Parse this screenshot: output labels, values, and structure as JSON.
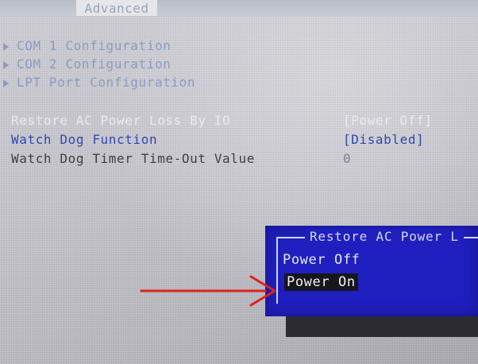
{
  "tab": {
    "label": "Advanced"
  },
  "submenus": [
    {
      "label": "COM 1 Configuration"
    },
    {
      "label": "COM 2 Configuration"
    },
    {
      "label": "LPT Port Configuration"
    }
  ],
  "settings": [
    {
      "label": "Restore AC Power Loss By IO",
      "value": "[Power Off]"
    },
    {
      "label": "Watch Dog Function",
      "value": "[Disabled]"
    },
    {
      "label": "Watch Dog Timer Time-Out Value",
      "value": "0"
    }
  ],
  "popup": {
    "title": "Restore AC Power L",
    "options": [
      {
        "label": "Power Off"
      },
      {
        "label": "Power On"
      }
    ],
    "selected_option": "Power On"
  },
  "colors": {
    "popup_bg": "#1f1fbf",
    "selected_setting": "#3048b0",
    "annotation_arrow": "#e0211c"
  }
}
